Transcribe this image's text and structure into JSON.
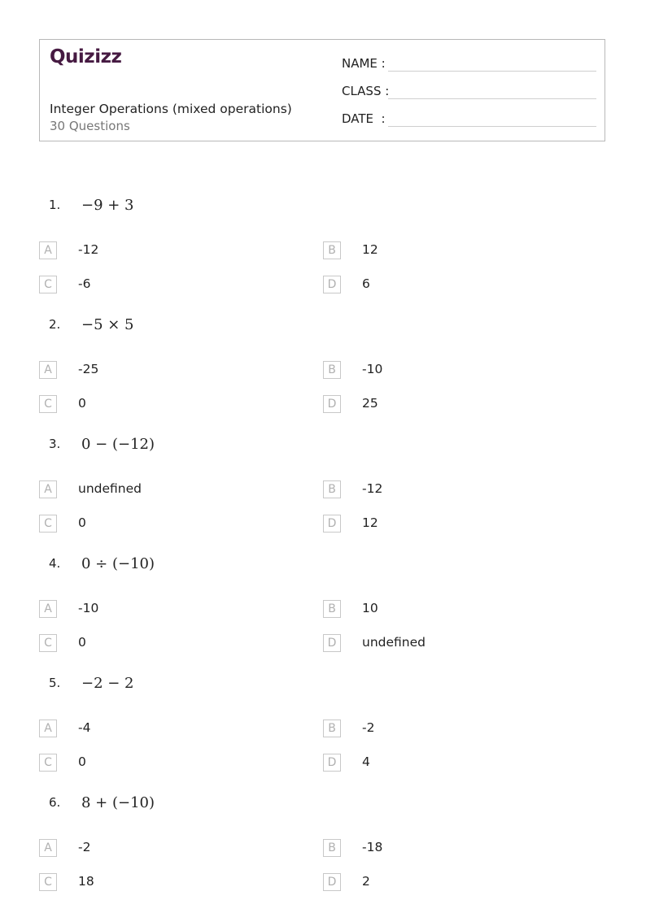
{
  "header": {
    "logo_text": "Quizizz",
    "title": "Integer Operations (mixed operations)",
    "question_count": "30 Questions",
    "fields": [
      {
        "label": "NAME :"
      },
      {
        "label": "CLASS :"
      },
      {
        "label": "DATE  :"
      }
    ]
  },
  "questions": [
    {
      "number": "1.",
      "expression": "−9 + 3",
      "options": [
        {
          "letter": "A",
          "text": "-12"
        },
        {
          "letter": "B",
          "text": "12"
        },
        {
          "letter": "C",
          "text": "-6"
        },
        {
          "letter": "D",
          "text": "6"
        }
      ]
    },
    {
      "number": "2.",
      "expression": "−5 × 5",
      "options": [
        {
          "letter": "A",
          "text": "-25"
        },
        {
          "letter": "B",
          "text": "-10"
        },
        {
          "letter": "C",
          "text": "0"
        },
        {
          "letter": "D",
          "text": "25"
        }
      ]
    },
    {
      "number": "3.",
      "expression": "0 − (−12)",
      "options": [
        {
          "letter": "A",
          "text": "undefined"
        },
        {
          "letter": "B",
          "text": "-12"
        },
        {
          "letter": "C",
          "text": "0"
        },
        {
          "letter": "D",
          "text": "12"
        }
      ]
    },
    {
      "number": "4.",
      "expression": "0 ÷ (−10)",
      "options": [
        {
          "letter": "A",
          "text": "-10"
        },
        {
          "letter": "B",
          "text": "10"
        },
        {
          "letter": "C",
          "text": "0"
        },
        {
          "letter": "D",
          "text": "undefined"
        }
      ]
    },
    {
      "number": "5.",
      "expression": "−2 − 2",
      "options": [
        {
          "letter": "A",
          "text": "-4"
        },
        {
          "letter": "B",
          "text": "-2"
        },
        {
          "letter": "C",
          "text": "0"
        },
        {
          "letter": "D",
          "text": "4"
        }
      ]
    },
    {
      "number": "6.",
      "expression": "8 + (−10)",
      "options": [
        {
          "letter": "A",
          "text": "-2"
        },
        {
          "letter": "B",
          "text": "-18"
        },
        {
          "letter": "C",
          "text": "18"
        },
        {
          "letter": "D",
          "text": "2"
        }
      ]
    }
  ]
}
